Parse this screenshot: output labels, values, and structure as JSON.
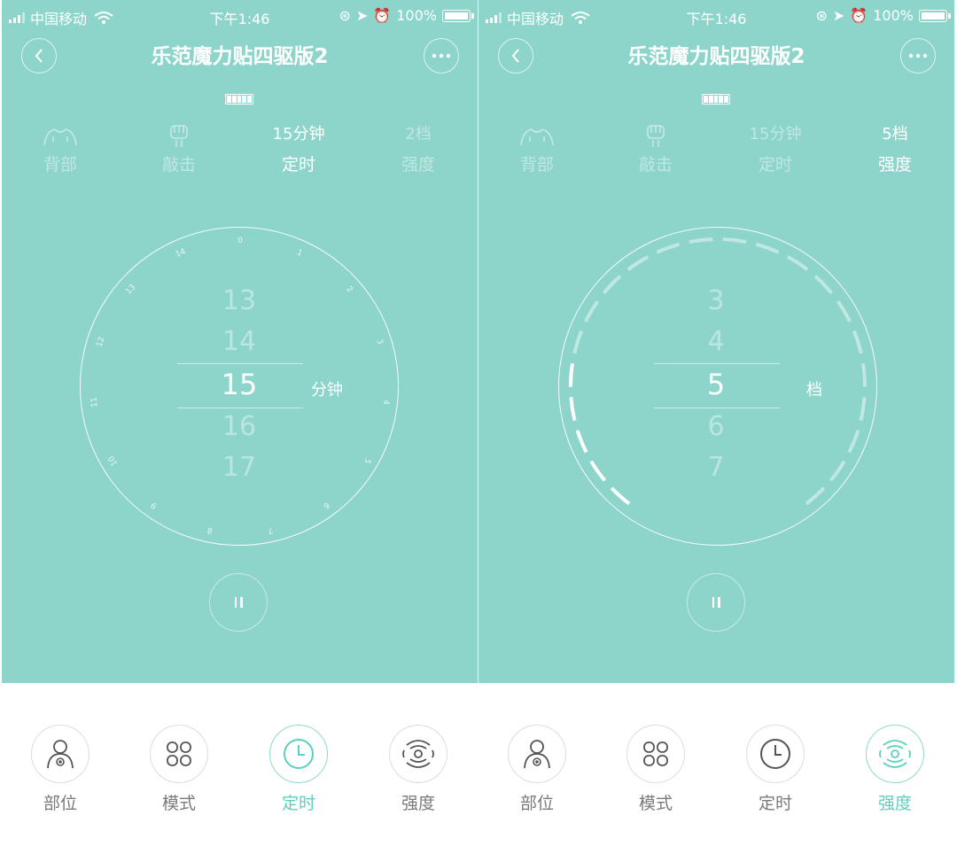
{
  "status_bar": {
    "carrier": "中国移动",
    "time": "下午1:46",
    "battery": "100%"
  },
  "header": {
    "title": "乐范魔力贴四驱版2"
  },
  "screens": [
    {
      "tabs": [
        {
          "top": "",
          "label": "背部",
          "icon": "back-body-icon",
          "active": false
        },
        {
          "top": "",
          "label": "敲击",
          "icon": "fist-icon",
          "active": false
        },
        {
          "top": "15分钟",
          "label": "定时",
          "icon": "",
          "active": true
        },
        {
          "top": "2档",
          "label": "强度",
          "icon": "",
          "active": false
        }
      ],
      "dial_ticks": [
        "0",
        "1",
        "2",
        "3",
        "4",
        "5",
        "6",
        "7",
        "8",
        "9",
        "10",
        "11",
        "12",
        "13",
        "14"
      ],
      "picker": {
        "values": [
          "13",
          "14",
          "15",
          "16",
          "17"
        ],
        "selected": "15",
        "unit": "分钟"
      },
      "intensity_level": null
    },
    {
      "tabs": [
        {
          "top": "",
          "label": "背部",
          "icon": "back-body-icon",
          "active": false
        },
        {
          "top": "",
          "label": "敲击",
          "icon": "fist-icon",
          "active": false
        },
        {
          "top": "15分钟",
          "label": "定时",
          "icon": "",
          "active": false
        },
        {
          "top": "5档",
          "label": "强度",
          "icon": "",
          "active": true
        }
      ],
      "picker": {
        "values": [
          "3",
          "4",
          "5",
          "6",
          "7"
        ],
        "selected": "5",
        "unit": "档"
      },
      "intensity_level": 5
    }
  ],
  "bottom_nav": [
    {
      "label": "部位",
      "icon": "person-icon"
    },
    {
      "label": "模式",
      "icon": "grid-icon"
    },
    {
      "label": "定时",
      "icon": "clock-icon"
    },
    {
      "label": "强度",
      "icon": "waves-icon"
    }
  ],
  "bottom_nav_active": [
    "定时",
    "强度"
  ],
  "colors": {
    "background_teal": "#8dd5cb",
    "active_accent": "#5ccfbd",
    "inactive_label": "#7a7a7a"
  }
}
